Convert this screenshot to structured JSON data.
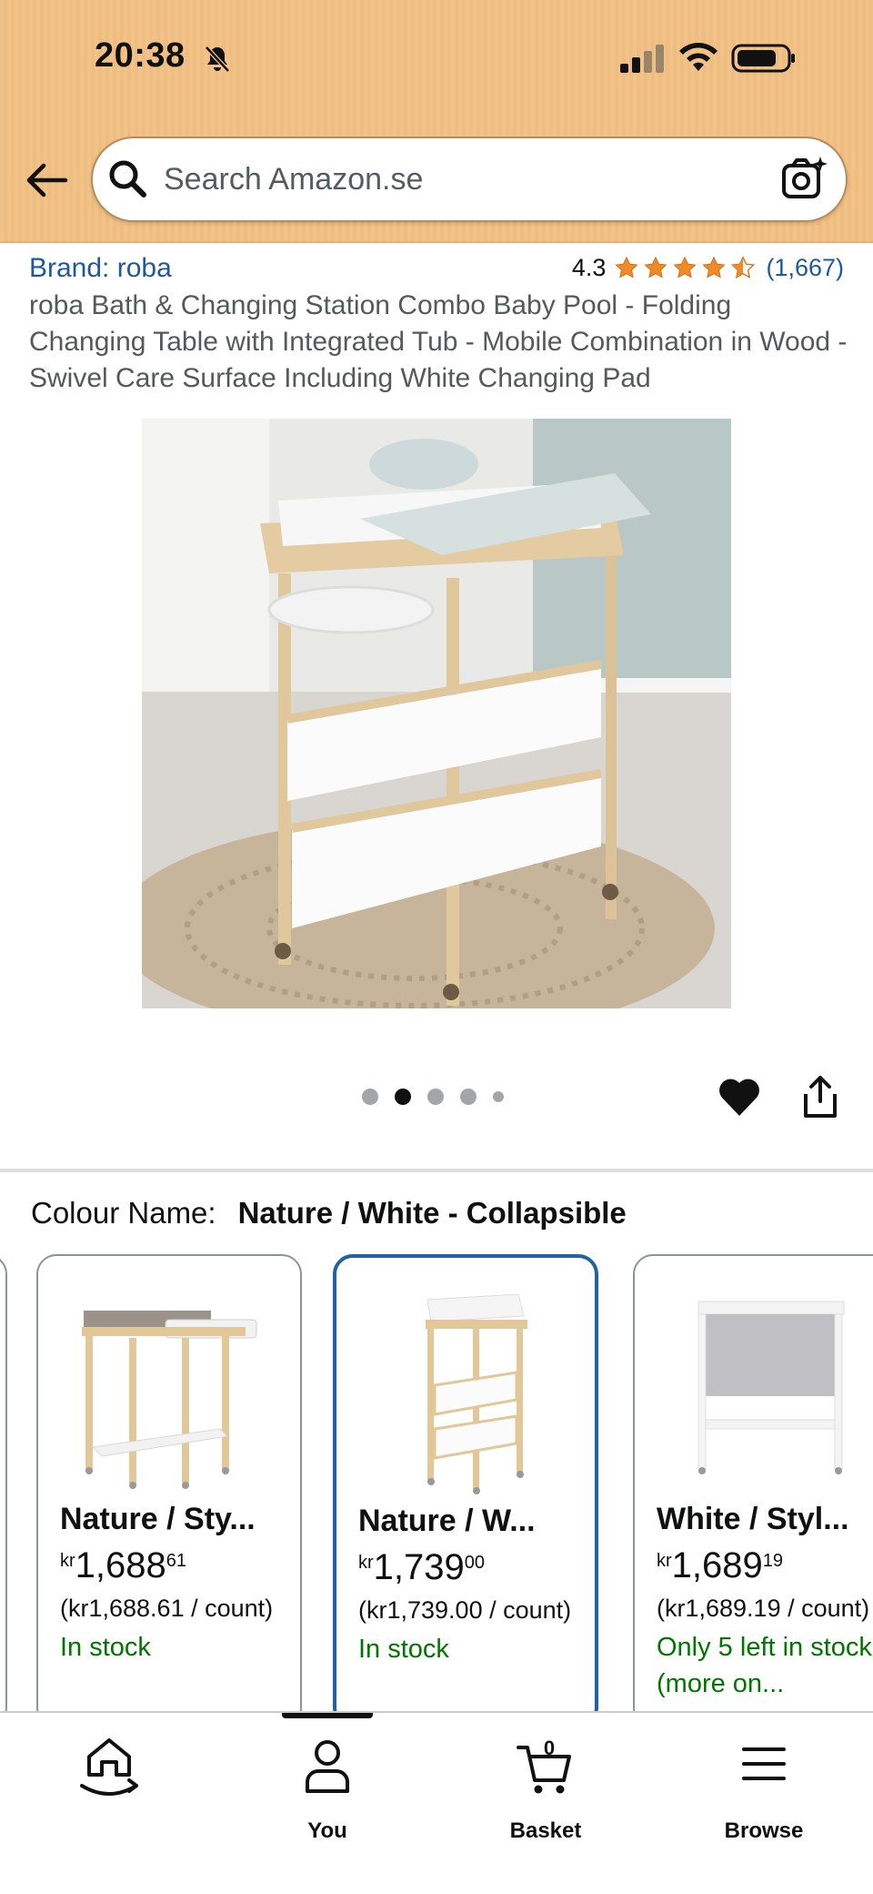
{
  "status_bar": {
    "time": "20:38"
  },
  "search": {
    "placeholder": "Search Amazon.se"
  },
  "product": {
    "brand": "Brand: roba",
    "rating_value": "4.3",
    "rating_stars": 4.3,
    "rating_count": "(1,667)",
    "title": "roba Bath & Changing Station Combo Baby Pool - Folding Changing Table with Integrated Tub - Mobile Combination in Wood - Swivel Care Surface Including White Changing Pad",
    "image_count": 5,
    "active_image_index": 1
  },
  "colour": {
    "label": "Colour Name:",
    "value": "Nature / White - Collapsible"
  },
  "variants": [
    {
      "name": "Nature / Sty...",
      "currency": "kr",
      "price_whole": "1,688",
      "price_fraction": "61",
      "unit_price": "(kr1,688.61 / count)",
      "stock": "In stock",
      "selected": false
    },
    {
      "name": "Nature / W...",
      "currency": "kr",
      "price_whole": "1,739",
      "price_fraction": "00",
      "unit_price": "(kr1,739.00 / count)",
      "stock": "In stock",
      "selected": true
    },
    {
      "name": "White / Styl...",
      "currency": "kr",
      "price_whole": "1,689",
      "price_fraction": "19",
      "unit_price": "(kr1,689.19 / count)",
      "stock": "Only 5 left in stock (more on...",
      "selected": false
    }
  ],
  "nav": {
    "home_label": "",
    "you_label": "You",
    "basket_label": "Basket",
    "basket_count": "0",
    "browse_label": "Browse"
  },
  "colors": {
    "header_bg": "#f2c389",
    "link_blue": "#1f5a96",
    "star_orange": "#f08a24",
    "in_stock_green": "#007600",
    "selected_border": "#2162a1"
  }
}
